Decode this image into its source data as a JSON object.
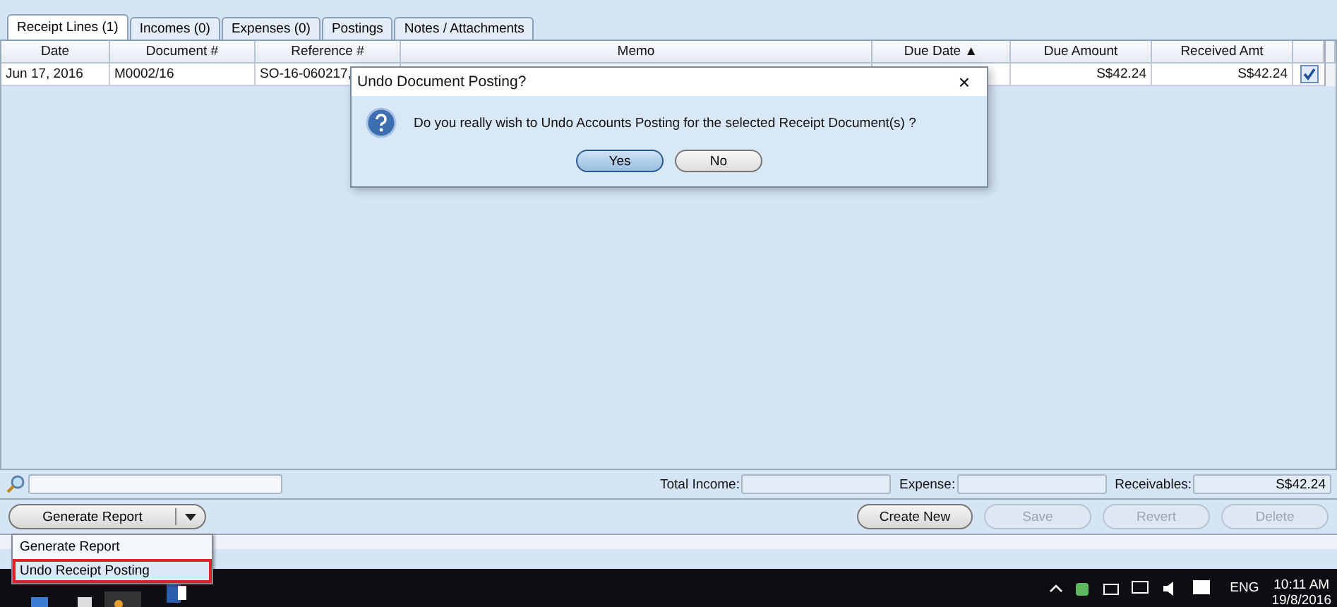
{
  "tabs": [
    {
      "label": "Receipt Lines (1)",
      "selected": true
    },
    {
      "label": "Incomes (0)",
      "selected": false
    },
    {
      "label": "Expenses (0)",
      "selected": false
    },
    {
      "label": "Postings",
      "selected": false
    },
    {
      "label": "Notes / Attachments",
      "selected": false
    }
  ],
  "table": {
    "columns": [
      "Date",
      "Document #",
      "Reference #",
      "Memo",
      "Due Date ▲",
      "Due Amount",
      "Received Amt"
    ],
    "rows": [
      {
        "cells": [
          "Jun 17, 2016",
          "M0002/16",
          "SO-16-060217,",
          "",
          "",
          "S$42.24",
          "S$42.24"
        ],
        "checked": true
      }
    ]
  },
  "totals": {
    "fields": [
      {
        "label": "Total Income:"
      },
      {
        "label": "Expense:"
      },
      {
        "label": "Receivables:",
        "value": "S$42.24"
      }
    ]
  },
  "split_button": {
    "label": "Generate Report"
  },
  "buttons": [
    {
      "label": "Create New",
      "disabled": false
    },
    {
      "label": "Save",
      "disabled": true
    },
    {
      "label": "Revert",
      "disabled": true
    },
    {
      "label": "Delete",
      "disabled": true
    }
  ],
  "menu": {
    "items": [
      {
        "label": "Generate Report",
        "selected": false
      },
      {
        "label": "Undo Receipt Posting",
        "selected": true
      }
    ]
  },
  "dialog": {
    "title": "Undo Document Posting?",
    "close": "×",
    "message": "Do you really wish to Undo Accounts Posting for the selected Receipt Document(s) ?",
    "buttons": [
      {
        "label": "Yes",
        "default": true
      },
      {
        "label": "No",
        "default": false
      }
    ]
  },
  "taskbar": {
    "language": "ENG",
    "time": "10:11 AM",
    "date": "19/8/2016"
  }
}
